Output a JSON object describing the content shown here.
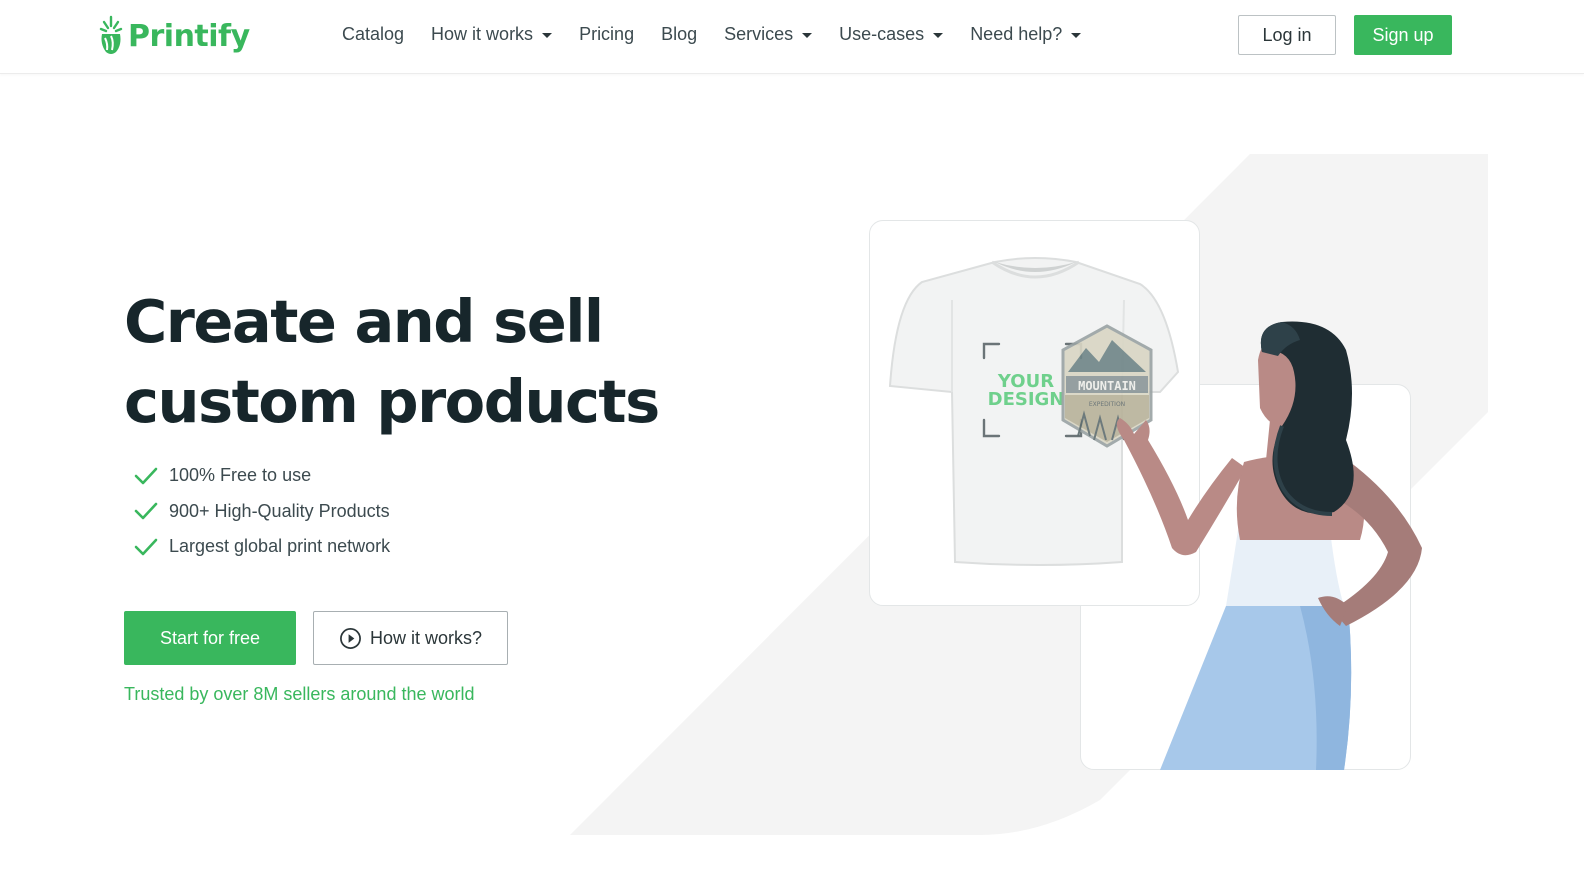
{
  "header": {
    "logo_text": "Printify",
    "nav": [
      {
        "label": "Catalog",
        "dropdown": false
      },
      {
        "label": "How it works",
        "dropdown": true
      },
      {
        "label": "Pricing",
        "dropdown": false
      },
      {
        "label": "Blog",
        "dropdown": false
      },
      {
        "label": "Services",
        "dropdown": true
      },
      {
        "label": "Use-cases",
        "dropdown": true
      },
      {
        "label": "Need help?",
        "dropdown": true
      }
    ],
    "login_label": "Log in",
    "signup_label": "Sign up"
  },
  "hero": {
    "title_line1": "Create and sell",
    "title_line2": "custom products",
    "features": [
      "100% Free to use",
      "900+ High-Quality Products",
      "Largest global print network"
    ],
    "start_label": "Start for free",
    "how_label": "How it works?",
    "trusted_text": "Trusted by over 8M sellers around the world"
  },
  "illustration": {
    "design_line1": "YOUR",
    "design_line2": "DESIGN",
    "badge_text": "MOUNTAIN",
    "badge_subtext": "EXPEDITION"
  },
  "colors": {
    "brand_green": "#39b75d",
    "heading": "#17262b",
    "body_text": "#3c4a4f",
    "bg_shape": "#f4f4f4",
    "skirt": "#a7c8ea",
    "skin": "#b98a86",
    "hair": "#1f2d33"
  },
  "icons": {
    "logo": "printify-logo-icon",
    "caret": "caret-down-icon",
    "check": "check-icon",
    "play": "play-circle-icon"
  }
}
